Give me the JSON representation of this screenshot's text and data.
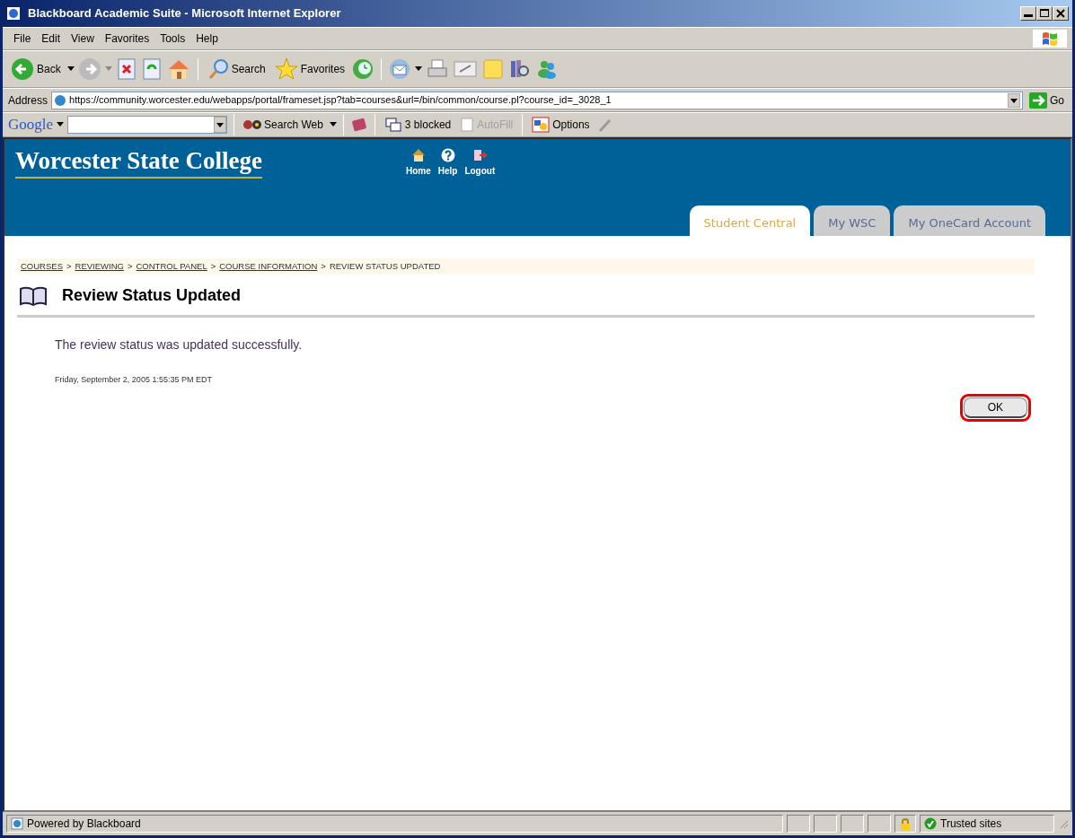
{
  "window": {
    "title": "Blackboard Academic Suite - Microsoft Internet Explorer"
  },
  "menu": [
    "File",
    "Edit",
    "View",
    "Favorites",
    "Tools",
    "Help"
  ],
  "toolbar": {
    "back": "Back",
    "search": "Search",
    "favorites": "Favorites"
  },
  "address": {
    "label": "Address",
    "value": "https://community.worcester.edu/webapps/portal/frameset.jsp?tab=courses&url=/bin/common/course.pl?course_id=_3028_1",
    "go": "Go"
  },
  "google_bar": {
    "logo": "Google",
    "search_web": "Search Web",
    "blocked": "3 blocked",
    "autofill": {
      "label": "AutoFill",
      "disabled": true
    },
    "options": "Options"
  },
  "site": {
    "logo": "Worcester State College",
    "nav": [
      {
        "label": "Home",
        "kind": "home"
      },
      {
        "label": "Help",
        "kind": "help"
      },
      {
        "label": "Logout",
        "kind": "logout"
      }
    ],
    "tabs": [
      {
        "label": "Student Central",
        "selected": true
      },
      {
        "label": "My WSC",
        "selected": false
      },
      {
        "label": "My OneCard Account",
        "selected": false
      }
    ]
  },
  "breadcrumb": [
    {
      "label": "COURSES",
      "kind": "link"
    },
    {
      "label": ">",
      "kind": "separator"
    },
    {
      "label": "REVIEWING",
      "kind": "link"
    },
    {
      "label": ">",
      "kind": "separator"
    },
    {
      "label": "CONTROL PANEL",
      "kind": "link"
    },
    {
      "label": ">",
      "kind": "separator"
    },
    {
      "label": "COURSE INFORMATION",
      "kind": "link"
    },
    {
      "label": ">",
      "kind": "separator"
    },
    {
      "label": "REVIEW STATUS UPDATED",
      "kind": "current"
    }
  ],
  "heading": "Review Status Updated",
  "message": "The review status was updated successfully.",
  "timestamp": "Friday, September 2, 2005 1:55:35 PM EDT",
  "ok_button": {
    "label": "OK",
    "highlighted": true
  },
  "status_bar": {
    "text": "Powered by Blackboard",
    "zone": "Trusted sites"
  }
}
